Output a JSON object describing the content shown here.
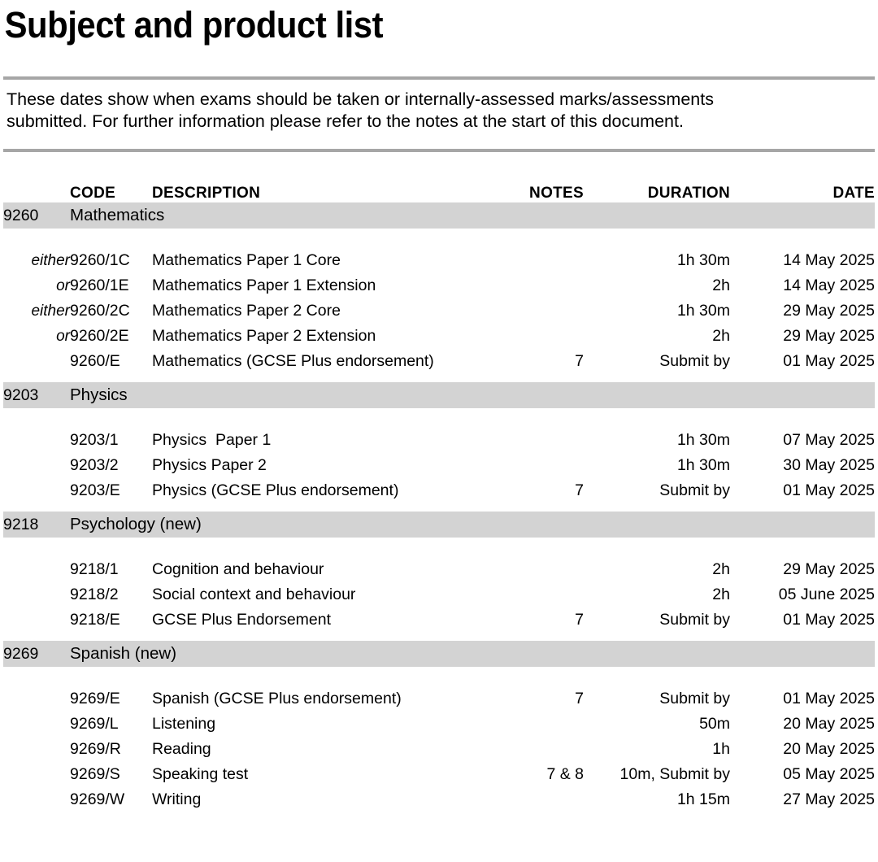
{
  "document": {
    "title": "Subject and product list",
    "intro_lines": [
      "These dates show when exams should be taken or internally-assessed marks/assessments",
      "submitted.  For further information please refer to the notes at the start of this document."
    ]
  },
  "table": {
    "headers": {
      "code": "CODE",
      "description": "DESCRIPTION",
      "notes": "NOTES",
      "duration": "DURATION",
      "date": "DATE"
    },
    "sections": [
      {
        "subject_code": "9260",
        "subject_name": "Mathematics",
        "rows": [
          {
            "qualifier": "either",
            "code": "9260/1C",
            "description": "Mathematics Paper 1 Core",
            "notes": "",
            "duration": "1h 30m",
            "date": "14 May 2025"
          },
          {
            "qualifier": "or",
            "code": "9260/1E",
            "description": "Mathematics Paper 1 Extension",
            "notes": "",
            "duration": "2h",
            "date": "14 May 2025"
          },
          {
            "qualifier": "either",
            "code": "9260/2C",
            "description": "Mathematics Paper 2 Core",
            "notes": "",
            "duration": "1h 30m",
            "date": "29 May 2025"
          },
          {
            "qualifier": "or",
            "code": "9260/2E",
            "description": "Mathematics Paper 2 Extension",
            "notes": "",
            "duration": "2h",
            "date": "29 May 2025"
          },
          {
            "qualifier": "",
            "code": "9260/E",
            "description": "Mathematics (GCSE Plus endorsement)",
            "notes": "7",
            "duration": "Submit by",
            "date": "01 May 2025"
          }
        ]
      },
      {
        "subject_code": "9203",
        "subject_name": "Physics",
        "rows": [
          {
            "qualifier": "",
            "code": "9203/1",
            "description": "Physics  Paper 1",
            "notes": "",
            "duration": "1h 30m",
            "date": "07 May 2025"
          },
          {
            "qualifier": "",
            "code": "9203/2",
            "description": "Physics Paper 2",
            "notes": "",
            "duration": "1h 30m",
            "date": "30 May 2025"
          },
          {
            "qualifier": "",
            "code": "9203/E",
            "description": "Physics (GCSE Plus endorsement)",
            "notes": "7",
            "duration": "Submit by",
            "date": "01 May 2025"
          }
        ]
      },
      {
        "subject_code": "9218",
        "subject_name": "Psychology (new)",
        "rows": [
          {
            "qualifier": "",
            "code": "9218/1",
            "description": "Cognition and behaviour",
            "notes": "",
            "duration": "2h",
            "date": "29 May 2025"
          },
          {
            "qualifier": "",
            "code": "9218/2",
            "description": "Social context and behaviour",
            "notes": "",
            "duration": "2h",
            "date": "05 June 2025"
          },
          {
            "qualifier": "",
            "code": "9218/E",
            "description": "GCSE Plus Endorsement",
            "notes": "7",
            "duration": "Submit by",
            "date": "01 May 2025"
          }
        ]
      },
      {
        "subject_code": "9269",
        "subject_name": "Spanish (new)",
        "rows": [
          {
            "qualifier": "",
            "code": "9269/E",
            "description": "Spanish (GCSE Plus endorsement)",
            "notes": "7",
            "duration": "Submit by",
            "date": "01 May 2025"
          },
          {
            "qualifier": "",
            "code": "9269/L",
            "description": "Listening",
            "notes": "",
            "duration": "50m",
            "date": "20 May 2025"
          },
          {
            "qualifier": "",
            "code": "9269/R",
            "description": "Reading",
            "notes": "",
            "duration": "1h",
            "date": "20 May 2025"
          },
          {
            "qualifier": "",
            "code": "9269/S",
            "description": "Speaking test",
            "notes": "7 & 8",
            "duration": "10m, Submit by",
            "date": "05 May 2025"
          },
          {
            "qualifier": "",
            "code": "9269/W",
            "description": "Writing",
            "notes": "",
            "duration": "1h 15m",
            "date": "27 May 2025"
          }
        ]
      }
    ]
  }
}
